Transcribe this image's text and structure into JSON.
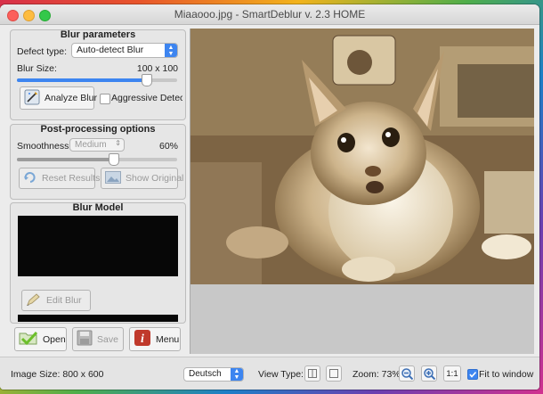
{
  "window": {
    "title": "Miaaooo.jpg - SmartDeblur v. 2.3 HOME"
  },
  "blur_parameters": {
    "title": "Blur parameters",
    "defect_type_label": "Defect type:",
    "defect_type_value": "Auto-detect Blur",
    "blur_size_label": "Blur Size:",
    "blur_size_value": "100 x 100",
    "analyze_label": "Analyze Blur",
    "aggressive_label": "Aggressive Detecti",
    "aggressive_checked": false
  },
  "post_processing": {
    "title": "Post-processing options",
    "smoothness_label": "Smoothness:",
    "smoothness_select": "Medium",
    "smoothness_percent": "60%",
    "smoothness_fraction": 0.6,
    "reset_label": "Reset Results",
    "show_original_label": "Show Original"
  },
  "blur_model": {
    "title": "Blur Model",
    "edit_label": "Edit Blur"
  },
  "actions": {
    "open_label": "Open",
    "save_label": "Save",
    "menu_label": "Menu"
  },
  "statusbar": {
    "image_size": "Image Size: 800 x 600",
    "language": "Deutsch",
    "view_type_label": "View Type:",
    "zoom_label": "Zoom: 73%",
    "one_to_one_label": "1:1",
    "fit_label": "Fit to window",
    "fit_checked": true
  },
  "icons": {
    "analyze": "magic-wand-icon",
    "reset": "reset-arrow-icon",
    "show_original": "image-icon",
    "edit": "pencil-icon",
    "open": "folder-check-icon",
    "save": "floppy-disk-icon",
    "menu": "info-icon",
    "zoom_out": "zoom-out-icon",
    "zoom_in": "zoom-in-icon"
  },
  "colors": {
    "accent": "#3d85f0",
    "menu_red": "#c0392b",
    "open_green": "#6cbf2a"
  }
}
